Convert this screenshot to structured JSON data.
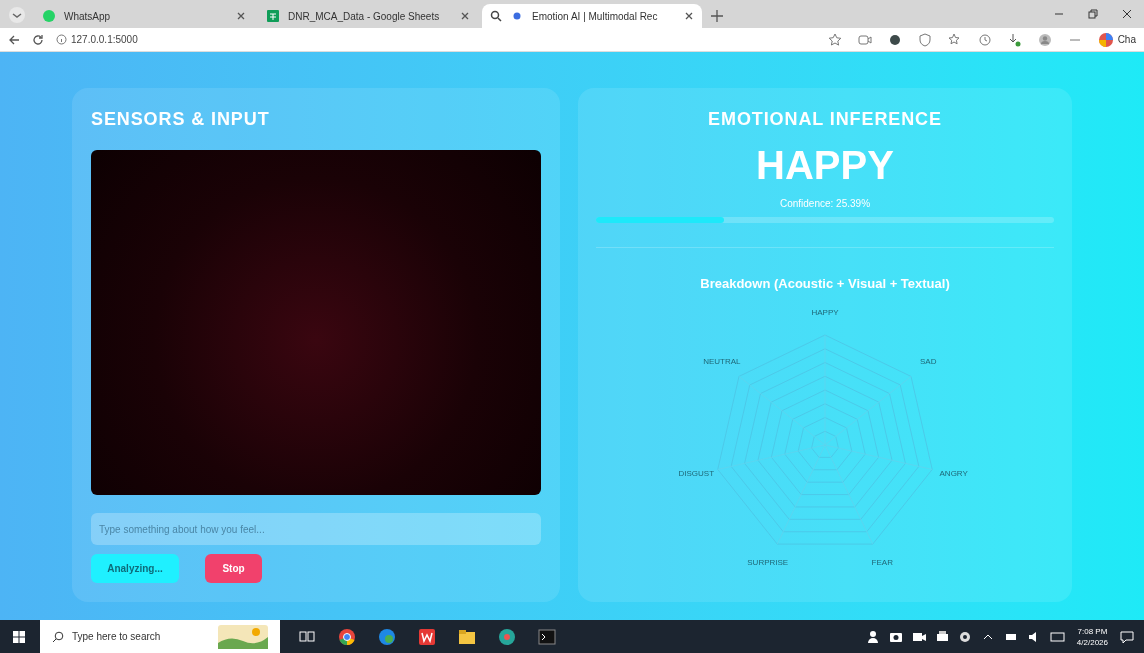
{
  "browser": {
    "tabs": [
      {
        "title": "WhatsApp",
        "selected": false
      },
      {
        "title": "DNR_MCA_Data - Google Sheets",
        "selected": false
      },
      {
        "title": "Emotion AI | Multimodal Rec",
        "selected": true
      }
    ],
    "address": "127.0.0.1:5000",
    "profile_label": "Cha"
  },
  "sensors": {
    "title": "SENSORS & INPUT",
    "text_input": {
      "placeholder": "Type something about how you feel..."
    },
    "analyze_button": "Analyzing...",
    "stop_button": "Stop"
  },
  "inference": {
    "title": "EMOTIONAL INFERENCE",
    "emotion": "HAPPY",
    "confidence": "Confidence: 25.39%",
    "level": 0.28,
    "breakdown_title": "Breakdown (Acoustic + Visual + Textual)",
    "radar_axes": [
      "HAPPY",
      "SAD",
      "ANGRY",
      "FEAR",
      "SURPRISE",
      "DISGUST",
      "NEUTRAL"
    ]
  },
  "taskbar": {
    "search_placeholder": "Type here to search",
    "time": "7:08 PM",
    "date": "4/2/2026"
  }
}
